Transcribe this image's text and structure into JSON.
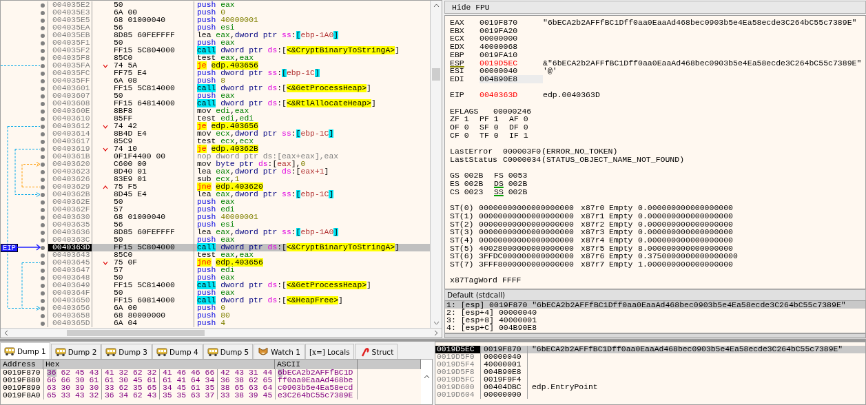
{
  "disassembly": {
    "eip_label": "EIP",
    "rows": [
      {
        "address": "004035E2",
        "bytes": "50",
        "ins": [
          {
            "kind": "push",
            "text": "push"
          },
          {
            "kind": "reg",
            "text": "eax"
          }
        ],
        "selected": false
      },
      {
        "address": "004035E3",
        "bytes": "6A 00",
        "ins": [
          {
            "kind": "push",
            "text": "push"
          },
          {
            "kind": "imm",
            "text": "0"
          }
        ],
        "selected": false
      },
      {
        "address": "004035E5",
        "bytes": "68 01000040",
        "ins": [
          {
            "kind": "push",
            "text": "push"
          },
          {
            "kind": "imm",
            "text": "40000001"
          }
        ],
        "selected": false
      },
      {
        "address": "004035EA",
        "bytes": "56",
        "ins": [
          {
            "kind": "push",
            "text": "push"
          },
          {
            "kind": "reg",
            "text": "esi"
          }
        ],
        "selected": false
      },
      {
        "address": "004035EB",
        "bytes": "8D85 60FEFFFF",
        "ins": [
          {
            "kind": "op",
            "text": "lea"
          },
          {
            "kind": "reg",
            "text": "eax"
          },
          {
            "kind": "punct",
            "text": ","
          },
          {
            "kind": "size",
            "text": "dword ptr "
          },
          {
            "kind": "seg",
            "text": "ss"
          },
          {
            "kind": "punct",
            "text": ":"
          },
          {
            "kind": "bracket",
            "text": "["
          },
          {
            "kind": "mem",
            "text": "ebp-1A0"
          },
          {
            "kind": "bracket",
            "text": "]"
          }
        ],
        "selected": false
      },
      {
        "address": "004035F1",
        "bytes": "50",
        "ins": [
          {
            "kind": "push",
            "text": "push"
          },
          {
            "kind": "reg",
            "text": "eax"
          }
        ],
        "selected": false
      },
      {
        "address": "004035F2",
        "bytes": "FF15 5C804000",
        "ins": [
          {
            "kind": "call",
            "text": "call"
          },
          {
            "kind": "size",
            "text": "dword ptr "
          },
          {
            "kind": "seg",
            "text": "ds"
          },
          {
            "kind": "punct",
            "text": ":["
          },
          {
            "kind": "symbol",
            "text": "<&CryptBinaryToStringA>"
          },
          {
            "kind": "punct",
            "text": "]"
          }
        ],
        "selected": false
      },
      {
        "address": "004035F8",
        "bytes": "85C0",
        "ins": [
          {
            "kind": "op",
            "text": "test"
          },
          {
            "kind": "reg",
            "text": "eax"
          },
          {
            "kind": "punct",
            "text": ","
          },
          {
            "kind": "reg",
            "text": "eax"
          }
        ],
        "selected": false
      },
      {
        "address": "004035FA",
        "bytes": "74 5A",
        "kind": "branch_down",
        "ins": [
          {
            "kind": "jump",
            "text": "je"
          },
          {
            "kind": "symbol",
            "text": "edp.403656"
          }
        ],
        "selected": false
      },
      {
        "address": "004035FC",
        "bytes": "FF75 E4",
        "ins": [
          {
            "kind": "push",
            "text": "push"
          },
          {
            "kind": "size",
            "text": "dword ptr "
          },
          {
            "kind": "seg",
            "text": "ss"
          },
          {
            "kind": "punct",
            "text": ":"
          },
          {
            "kind": "bracket",
            "text": "["
          },
          {
            "kind": "mem",
            "text": "ebp-1C"
          },
          {
            "kind": "bracket",
            "text": "]"
          }
        ],
        "selected": false
      },
      {
        "address": "004035FF",
        "bytes": "6A 08",
        "ins": [
          {
            "kind": "push",
            "text": "push"
          },
          {
            "kind": "imm",
            "text": "8"
          }
        ],
        "selected": false
      },
      {
        "address": "00403601",
        "bytes": "FF15 5C814000",
        "ins": [
          {
            "kind": "call",
            "text": "call"
          },
          {
            "kind": "size",
            "text": "dword ptr "
          },
          {
            "kind": "seg",
            "text": "ds"
          },
          {
            "kind": "punct",
            "text": ":["
          },
          {
            "kind": "symbol",
            "text": "<&GetProcessHeap>"
          },
          {
            "kind": "punct",
            "text": "]"
          }
        ],
        "selected": false
      },
      {
        "address": "00403607",
        "bytes": "50",
        "ins": [
          {
            "kind": "push",
            "text": "push"
          },
          {
            "kind": "reg",
            "text": "eax"
          }
        ],
        "selected": false
      },
      {
        "address": "00403608",
        "bytes": "FF15 64814000",
        "ins": [
          {
            "kind": "call",
            "text": "call"
          },
          {
            "kind": "size",
            "text": "dword ptr "
          },
          {
            "kind": "seg",
            "text": "ds"
          },
          {
            "kind": "punct",
            "text": ":["
          },
          {
            "kind": "symbol",
            "text": "<&RtlAllocateHeap>"
          },
          {
            "kind": "punct",
            "text": "]"
          }
        ],
        "selected": false
      },
      {
        "address": "0040360E",
        "bytes": "8BF8",
        "ins": [
          {
            "kind": "op",
            "text": "mov"
          },
          {
            "kind": "reg",
            "text": "edi"
          },
          {
            "kind": "punct",
            "text": ","
          },
          {
            "kind": "reg",
            "text": "eax"
          }
        ],
        "selected": false
      },
      {
        "address": "00403610",
        "bytes": "85FF",
        "ins": [
          {
            "kind": "op",
            "text": "test"
          },
          {
            "kind": "reg",
            "text": "edi"
          },
          {
            "kind": "punct",
            "text": ","
          },
          {
            "kind": "reg",
            "text": "edi"
          }
        ],
        "selected": false
      },
      {
        "address": "00403612",
        "bytes": "74 42",
        "kind": "branch_down",
        "ins": [
          {
            "kind": "jump",
            "text": "je"
          },
          {
            "kind": "symbol",
            "text": "edp.403656"
          }
        ],
        "selected": false
      },
      {
        "address": "00403614",
        "bytes": "8B4D E4",
        "ins": [
          {
            "kind": "op",
            "text": "mov"
          },
          {
            "kind": "reg",
            "text": "ecx"
          },
          {
            "kind": "punct",
            "text": ","
          },
          {
            "kind": "size",
            "text": "dword ptr "
          },
          {
            "kind": "seg",
            "text": "ss"
          },
          {
            "kind": "punct",
            "text": ":"
          },
          {
            "kind": "bracket",
            "text": "["
          },
          {
            "kind": "mem",
            "text": "ebp-1C"
          },
          {
            "kind": "bracket",
            "text": "]"
          }
        ],
        "selected": false
      },
      {
        "address": "00403617",
        "bytes": "85C9",
        "ins": [
          {
            "kind": "op",
            "text": "test"
          },
          {
            "kind": "reg",
            "text": "ecx"
          },
          {
            "kind": "punct",
            "text": ","
          },
          {
            "kind": "reg",
            "text": "ecx"
          }
        ],
        "selected": false
      },
      {
        "address": "00403619",
        "bytes": "74 10",
        "kind": "branch_down",
        "ins": [
          {
            "kind": "jump",
            "text": "je"
          },
          {
            "kind": "symbol",
            "text": "edp.40362B"
          }
        ],
        "selected": false
      },
      {
        "address": "0040361B",
        "bytes": "0F1F4400 00",
        "ins": [
          {
            "kind": "nop",
            "text": "nop dword ptr ds:[eax+eax],eax"
          }
        ],
        "selected": false
      },
      {
        "address": "00403620",
        "bytes": "C600 00",
        "ins": [
          {
            "kind": "op",
            "text": "mov"
          },
          {
            "kind": "size",
            "text": "byte ptr "
          },
          {
            "kind": "seg",
            "text": "ds"
          },
          {
            "kind": "punct",
            "text": ":["
          },
          {
            "kind": "mem",
            "text": "eax"
          },
          {
            "kind": "punct",
            "text": "],"
          },
          {
            "kind": "imm",
            "text": "0"
          }
        ],
        "selected": false
      },
      {
        "address": "00403623",
        "bytes": "8D40 01",
        "ins": [
          {
            "kind": "op",
            "text": "lea"
          },
          {
            "kind": "reg",
            "text": "eax"
          },
          {
            "kind": "punct",
            "text": ","
          },
          {
            "kind": "size",
            "text": "dword ptr "
          },
          {
            "kind": "seg",
            "text": "ds"
          },
          {
            "kind": "punct",
            "text": ":["
          },
          {
            "kind": "mem",
            "text": "eax+1"
          },
          {
            "kind": "punct",
            "text": "]"
          }
        ],
        "selected": false
      },
      {
        "address": "00403626",
        "bytes": "83E9 01",
        "ins": [
          {
            "kind": "op",
            "text": "sub"
          },
          {
            "kind": "reg",
            "text": "ecx"
          },
          {
            "kind": "punct",
            "text": ","
          },
          {
            "kind": "imm",
            "text": "1"
          }
        ],
        "selected": false
      },
      {
        "address": "00403629",
        "bytes": "75 F5",
        "kind": "branch_up",
        "ins": [
          {
            "kind": "jump",
            "text": "jne"
          },
          {
            "kind": "symbol",
            "text": "edp.403620"
          }
        ],
        "selected": false
      },
      {
        "address": "0040362B",
        "bytes": "8D45 E4",
        "ins": [
          {
            "kind": "op",
            "text": "lea"
          },
          {
            "kind": "reg",
            "text": "eax"
          },
          {
            "kind": "punct",
            "text": ","
          },
          {
            "kind": "size",
            "text": "dword ptr "
          },
          {
            "kind": "seg",
            "text": "ss"
          },
          {
            "kind": "punct",
            "text": ":"
          },
          {
            "kind": "bracket",
            "text": "["
          },
          {
            "kind": "mem",
            "text": "ebp-1C"
          },
          {
            "kind": "bracket",
            "text": "]"
          }
        ],
        "selected": false
      },
      {
        "address": "0040362E",
        "bytes": "50",
        "ins": [
          {
            "kind": "push",
            "text": "push"
          },
          {
            "kind": "reg",
            "text": "eax"
          }
        ],
        "selected": false
      },
      {
        "address": "0040362F",
        "bytes": "57",
        "ins": [
          {
            "kind": "push",
            "text": "push"
          },
          {
            "kind": "reg",
            "text": "edi"
          }
        ],
        "selected": false
      },
      {
        "address": "00403630",
        "bytes": "68 01000040",
        "ins": [
          {
            "kind": "push",
            "text": "push"
          },
          {
            "kind": "imm",
            "text": "40000001"
          }
        ],
        "selected": false
      },
      {
        "address": "00403635",
        "bytes": "56",
        "ins": [
          {
            "kind": "push",
            "text": "push"
          },
          {
            "kind": "reg",
            "text": "esi"
          }
        ],
        "selected": false
      },
      {
        "address": "00403636",
        "bytes": "8D85 60FEFFFF",
        "ins": [
          {
            "kind": "op",
            "text": "lea"
          },
          {
            "kind": "reg",
            "text": "eax"
          },
          {
            "kind": "punct",
            "text": ","
          },
          {
            "kind": "size",
            "text": "dword ptr "
          },
          {
            "kind": "seg",
            "text": "ss"
          },
          {
            "kind": "punct",
            "text": ":"
          },
          {
            "kind": "bracket",
            "text": "["
          },
          {
            "kind": "mem",
            "text": "ebp-1A0"
          },
          {
            "kind": "bracket",
            "text": "]"
          }
        ],
        "selected": false
      },
      {
        "address": "0040363C",
        "bytes": "50",
        "ins": [
          {
            "kind": "push",
            "text": "push"
          },
          {
            "kind": "reg",
            "text": "eax"
          }
        ],
        "selected": false
      },
      {
        "address": "0040363D",
        "bytes": "FF15 5C804000",
        "ins": [
          {
            "kind": "call",
            "text": "call"
          },
          {
            "kind": "size",
            "text": "dword ptr "
          },
          {
            "kind": "seg",
            "text": "ds"
          },
          {
            "kind": "punct",
            "text": ":["
          },
          {
            "kind": "symbol",
            "text": "<&CryptBinaryToStringA>"
          },
          {
            "kind": "punct",
            "text": "]"
          }
        ],
        "selected": true
      },
      {
        "address": "00403643",
        "bytes": "85C0",
        "ins": [
          {
            "kind": "op",
            "text": "test"
          },
          {
            "kind": "reg",
            "text": "eax"
          },
          {
            "kind": "punct",
            "text": ","
          },
          {
            "kind": "reg",
            "text": "eax"
          }
        ],
        "selected": false
      },
      {
        "address": "00403645",
        "bytes": "75 0F",
        "kind": "branch_down",
        "ins": [
          {
            "kind": "jump",
            "text": "jne"
          },
          {
            "kind": "symbol",
            "text": "edp.403656"
          }
        ],
        "selected": false
      },
      {
        "address": "00403647",
        "bytes": "57",
        "ins": [
          {
            "kind": "push",
            "text": "push"
          },
          {
            "kind": "reg",
            "text": "edi"
          }
        ],
        "selected": false
      },
      {
        "address": "00403648",
        "bytes": "50",
        "ins": [
          {
            "kind": "push",
            "text": "push"
          },
          {
            "kind": "reg",
            "text": "eax"
          }
        ],
        "selected": false
      },
      {
        "address": "00403649",
        "bytes": "FF15 5C814000",
        "ins": [
          {
            "kind": "call",
            "text": "call"
          },
          {
            "kind": "size",
            "text": "dword ptr "
          },
          {
            "kind": "seg",
            "text": "ds"
          },
          {
            "kind": "punct",
            "text": ":["
          },
          {
            "kind": "symbol",
            "text": "<&GetProcessHeap>"
          },
          {
            "kind": "punct",
            "text": "]"
          }
        ],
        "selected": false
      },
      {
        "address": "0040364F",
        "bytes": "50",
        "ins": [
          {
            "kind": "push",
            "text": "push"
          },
          {
            "kind": "reg",
            "text": "eax"
          }
        ],
        "selected": false
      },
      {
        "address": "00403650",
        "bytes": "FF15 60814000",
        "ins": [
          {
            "kind": "call",
            "text": "call"
          },
          {
            "kind": "size",
            "text": "dword ptr "
          },
          {
            "kind": "seg",
            "text": "ds"
          },
          {
            "kind": "punct",
            "text": ":["
          },
          {
            "kind": "symbol",
            "text": "<&HeapFree>"
          },
          {
            "kind": "punct",
            "text": "]"
          }
        ],
        "selected": false
      },
      {
        "address": "00403656",
        "bytes": "6A 00",
        "ins": [
          {
            "kind": "push",
            "text": "push"
          },
          {
            "kind": "imm",
            "text": "0"
          }
        ],
        "selected": false
      },
      {
        "address": "00403658",
        "bytes": "68 80000000",
        "ins": [
          {
            "kind": "push",
            "text": "push"
          },
          {
            "kind": "imm",
            "text": "80"
          }
        ],
        "selected": false
      },
      {
        "address": "0040365D",
        "bytes": "6A 04",
        "ins": [
          {
            "kind": "push",
            "text": "push"
          },
          {
            "kind": "imm",
            "text": "4"
          }
        ],
        "selected": false
      }
    ]
  },
  "registers_panel": {
    "button": "Hide FPU",
    "general": [
      {
        "name": "EAX",
        "value": "0019F870",
        "comment": "\"6bECA2b2AFFfBC1Dff0aa0EaaAd468bec0903b5e4Ea58ecde3C264bC55c7389E\"",
        "changed": false,
        "marked": false,
        "selected": false
      },
      {
        "name": "EBX",
        "value": "0019FA20",
        "changed": false,
        "marked": false,
        "selected": false
      },
      {
        "name": "ECX",
        "value": "00000000",
        "changed": false,
        "marked": false,
        "selected": false
      },
      {
        "name": "EDX",
        "value": "40000068",
        "changed": false,
        "marked": false,
        "selected": false
      },
      {
        "name": "EBP",
        "value": "0019FA10",
        "changed": false,
        "marked": false,
        "selected": false
      },
      {
        "name": "ESP",
        "value": "0019D5EC",
        "comment": "&\"6bECA2b2AFFfBC1Dff0aa0EaaAd468bec0903b5e4Ea58ecde3C264bC55c7389E\"",
        "changed": true,
        "marked": true,
        "selected": false
      },
      {
        "name": "ESI",
        "value": "00000040",
        "comment": "'@'",
        "changed": false,
        "marked": false,
        "selected": false
      },
      {
        "name": "EDI",
        "value": "004B90E8",
        "changed": false,
        "marked": false,
        "selected": true
      }
    ],
    "eip": {
      "name": "EIP",
      "value": "0040363D",
      "comment": "edp.0040363D",
      "changed": true
    },
    "eflags": {
      "name": "EFLAGS",
      "value": "00000246"
    },
    "flags": [
      [
        {
          "name": "ZF",
          "value": "1"
        },
        {
          "name": "PF",
          "value": "1"
        },
        {
          "name": "AF",
          "value": "0"
        }
      ],
      [
        {
          "name": "OF",
          "value": "0"
        },
        {
          "name": "SF",
          "value": "0"
        },
        {
          "name": "DF",
          "value": "0"
        }
      ],
      [
        {
          "name": "CF",
          "value": "0"
        },
        {
          "name": "TF",
          "value": "0"
        },
        {
          "name": "IF",
          "value": "1"
        }
      ]
    ],
    "last": [
      {
        "name": "LastError",
        "value": "000003F0",
        "comment": "(ERROR_NO_TOKEN)"
      },
      {
        "name": "LastStatus",
        "value": "C0000034",
        "comment": "(STATUS_OBJECT_NAME_NOT_FOUND)"
      }
    ],
    "segments": [
      [
        {
          "name": "GS",
          "value": "002B",
          "marked": false
        },
        {
          "name": "FS",
          "value": "0053",
          "marked": false
        }
      ],
      [
        {
          "name": "ES",
          "value": "002B",
          "marked": false
        },
        {
          "name": "DS",
          "value": "002B",
          "marked": true
        }
      ],
      [
        {
          "name": "CS",
          "value": "0023",
          "marked": false
        },
        {
          "name": "SS",
          "value": "002B",
          "marked": true
        }
      ]
    ],
    "fpu": [
      {
        "name": "ST(0)",
        "raw": "00000000000000000000",
        "reg": "x87r0",
        "tag": "Empty",
        "value": "0.000000000000000000"
      },
      {
        "name": "ST(1)",
        "raw": "00000000000000000000",
        "reg": "x87r1",
        "tag": "Empty",
        "value": "0.000000000000000000"
      },
      {
        "name": "ST(2)",
        "raw": "00000000000000000000",
        "reg": "x87r2",
        "tag": "Empty",
        "value": "0.000000000000000000"
      },
      {
        "name": "ST(3)",
        "raw": "00000000000000000000",
        "reg": "x87r3",
        "tag": "Empty",
        "value": "0.000000000000000000"
      },
      {
        "name": "ST(4)",
        "raw": "00000000000000000000",
        "reg": "x87r4",
        "tag": "Empty",
        "value": "0.000000000000000000"
      },
      {
        "name": "ST(5)",
        "raw": "40028000000000000000",
        "reg": "x87r5",
        "tag": "Empty",
        "value": "8.000000000000000000"
      },
      {
        "name": "ST(6)",
        "raw": "3FFDC000000000000000",
        "reg": "x87r6",
        "tag": "Empty",
        "value": "0.3750000000000000000"
      },
      {
        "name": "ST(7)",
        "raw": "3FFF8000000000000000",
        "reg": "x87r7",
        "tag": "Empty",
        "value": "1.000000000000000000"
      }
    ],
    "tagword": {
      "name": "x87TagWord",
      "value": "FFFF"
    }
  },
  "call_args": {
    "title": "Default (stdcall)",
    "rows": [
      {
        "index": "1:",
        "location": "[esp]",
        "value": "0019F870",
        "comment": "\"6bECA2b2AFFfBC1Dff0aa0EaaAd468bec0903b5e4Ea58ecde3C264bC55c7389E\"",
        "selected": true
      },
      {
        "index": "2:",
        "location": "[esp+4]",
        "value": "00000040",
        "selected": false
      },
      {
        "index": "3:",
        "location": "[esp+8]",
        "value": "40000001",
        "selected": false
      },
      {
        "index": "4:",
        "location": "[esp+C]",
        "value": "004B90E8",
        "selected": false
      }
    ]
  },
  "dump": {
    "tabs": [
      {
        "label": "Dump 1",
        "kind": "dump",
        "selected": true
      },
      {
        "label": "Dump 2",
        "kind": "dump",
        "selected": false
      },
      {
        "label": "Dump 3",
        "kind": "dump",
        "selected": false
      },
      {
        "label": "Dump 4",
        "kind": "dump",
        "selected": false
      },
      {
        "label": "Dump 5",
        "kind": "dump",
        "selected": false
      },
      {
        "label": "Watch 1",
        "kind": "watch",
        "selected": false
      },
      {
        "label": "Locals",
        "kind": "locals",
        "icon_text": "[x=]",
        "selected": false
      },
      {
        "label": "Struct",
        "kind": "struct",
        "selected": false
      }
    ],
    "columns": [
      "Address",
      "Hex",
      "ASCII"
    ],
    "rows": [
      {
        "address": "0019F870",
        "groups": [
          [
            "36",
            "62",
            "45",
            "43"
          ],
          [
            "41",
            "32",
            "62",
            "32"
          ],
          [
            "41",
            "46",
            "46",
            "66"
          ],
          [
            "42",
            "43",
            "31",
            "44"
          ]
        ],
        "ascii": "6bECA2b2AFFfBC1D",
        "selected": true
      },
      {
        "address": "0019F880",
        "groups": [
          [
            "66",
            "66",
            "30",
            "61"
          ],
          [
            "61",
            "30",
            "45",
            "61"
          ],
          [
            "61",
            "41",
            "64",
            "34"
          ],
          [
            "36",
            "38",
            "62",
            "65"
          ]
        ],
        "ascii": "ff0aa0EaaAd468be",
        "selected": false
      },
      {
        "address": "0019F890",
        "groups": [
          [
            "63",
            "30",
            "39",
            "30"
          ],
          [
            "33",
            "62",
            "35",
            "65"
          ],
          [
            "34",
            "45",
            "61",
            "35"
          ],
          [
            "38",
            "65",
            "63",
            "64"
          ]
        ],
        "ascii": "c0903b5e4Ea58ecd",
        "selected": false
      },
      {
        "address": "0019F8A0",
        "groups": [
          [
            "65",
            "33",
            "43",
            "32"
          ],
          [
            "36",
            "34",
            "62",
            "43"
          ],
          [
            "35",
            "35",
            "63",
            "37"
          ],
          [
            "33",
            "38",
            "39",
            "45"
          ]
        ],
        "ascii": "e3C264bC55c7389E",
        "selected": false
      }
    ]
  },
  "stack": {
    "rows": [
      {
        "address": "0019D5EC",
        "value": "0019F870",
        "comment": "\"6bECA2b2AFFfBC1Dff0aa0EaaAd468bec0903b5e4Ea58ecde3C264bC55c7389E\"",
        "selected": true
      },
      {
        "address": "0019D5F0",
        "value": "00000040",
        "selected": false
      },
      {
        "address": "0019D5F4",
        "value": "40000001",
        "selected": false
      },
      {
        "address": "0019D5F8",
        "value": "004B90E8",
        "selected": false
      },
      {
        "address": "0019D5FC",
        "value": "0019F9F4",
        "selected": false
      },
      {
        "address": "0019D600",
        "value": "00404DBC",
        "comment": "edp.EntryPoint",
        "selected": false
      },
      {
        "address": "0019D604",
        "value": "00000000",
        "selected": false
      }
    ]
  }
}
